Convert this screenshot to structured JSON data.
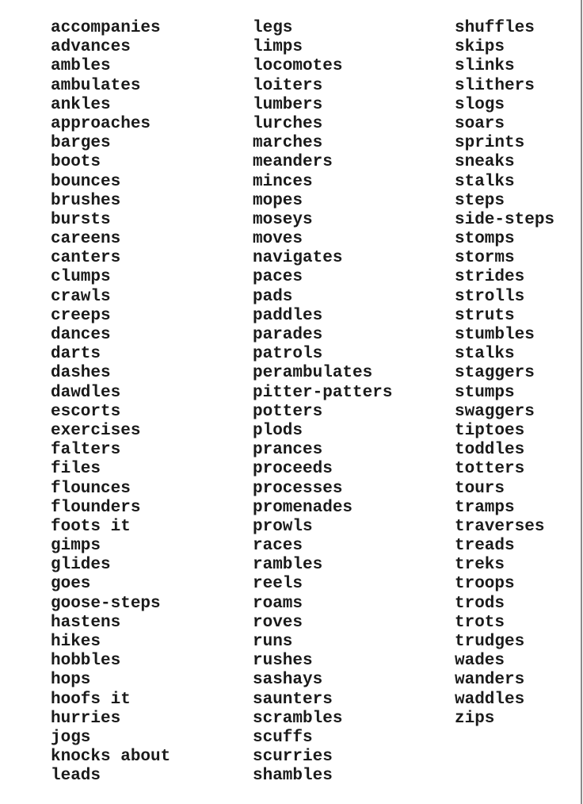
{
  "document": {
    "columns": [
      {
        "words": [
          "accompanies",
          "advances",
          "ambles",
          "ambulates",
          "ankles",
          "approaches",
          "barges",
          "boots",
          "bounces",
          "brushes",
          "bursts",
          "careens",
          "canters",
          "clumps",
          "crawls",
          "creeps",
          "dances",
          "darts",
          "dashes",
          "dawdles",
          "escorts",
          "exercises",
          "falters",
          "files",
          "flounces",
          "flounders",
          "foots it",
          "gimps",
          "glides",
          "goes",
          "goose-steps",
          "hastens",
          "hikes",
          "hobbles",
          "hops",
          "hoofs it",
          "hurries",
          "jogs",
          "knocks about",
          "leads"
        ]
      },
      {
        "words": [
          "legs",
          "limps",
          "locomotes",
          "loiters",
          "lumbers",
          "lurches",
          "marches",
          "meanders",
          "minces",
          "mopes",
          "moseys",
          "moves",
          "navigates",
          "paces",
          "pads",
          "paddles",
          "parades",
          "patrols",
          "perambulates",
          "pitter-patters",
          "potters",
          "plods",
          "prances",
          "proceeds",
          "processes",
          "promenades",
          "prowls",
          "races",
          "rambles",
          "reels",
          "roams",
          "roves",
          "runs",
          "rushes",
          "sashays",
          "saunters",
          "scrambles",
          "scuffs",
          "scurries",
          "shambles"
        ]
      },
      {
        "words": [
          "shuffles",
          "skips",
          "slinks",
          "slithers",
          "slogs",
          "soars",
          "sprints",
          "sneaks",
          "stalks",
          "steps",
          "side-steps",
          "stomps",
          "storms",
          "strides",
          "strolls",
          "struts",
          "stumbles",
          "stalks",
          "staggers",
          "stumps",
          "swaggers",
          "tiptoes",
          "toddles",
          "totters",
          "tours",
          "tramps",
          "traverses",
          "treads",
          "treks",
          "troops",
          "trods",
          "trots",
          "trudges",
          "wades",
          "wanders",
          "waddles",
          "zips"
        ]
      }
    ]
  }
}
